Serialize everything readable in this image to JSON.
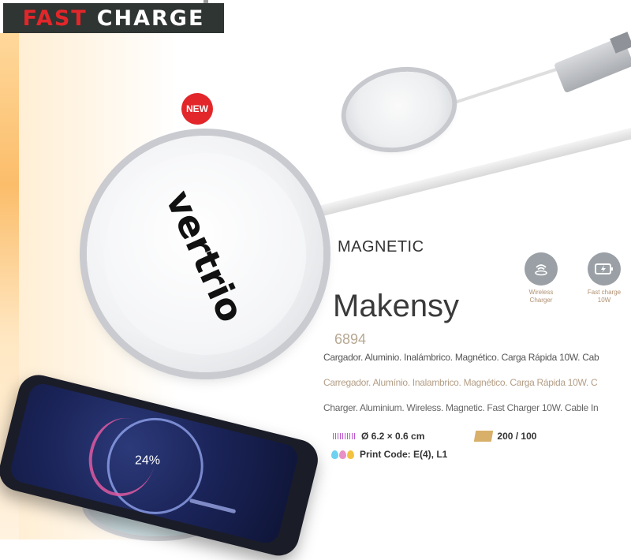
{
  "banner": {
    "word1": "FAST",
    "word2": "CHARGE"
  },
  "badge": {
    "label": "NEW"
  },
  "brand_logo": "vertrio",
  "phone_screen": {
    "percent": "24%"
  },
  "product": {
    "category": "MAGNETIC",
    "name": "Makensy",
    "code": "6894"
  },
  "features": [
    {
      "icon": "wireless-charger-icon",
      "label_line1": "Wireless",
      "label_line2": "Charger"
    },
    {
      "icon": "fast-charge-battery-icon",
      "label_line1": "Fast charge",
      "label_line2": "10W"
    }
  ],
  "descriptions": {
    "es": "Cargador. Aluminio. Inalámbrico. Magnético. Carga Rápida 10W. Cab",
    "pt": "Carregador. Alumínio. Inalambrico. Magnético. Carga Rápida 10W. C",
    "en": "Charger. Aluminium. Wireless. Magnetic. Fast Charger 10W. Cable In"
  },
  "specs": {
    "dimensions": "Ø 6.2 × 0.6 cm",
    "packaging": "200 / 100",
    "print_code": "Print Code: E(4), L1"
  },
  "colors": {
    "accent_red": "#e2262a",
    "banner_bg": "#2f3532",
    "beige": "#b49e86"
  }
}
